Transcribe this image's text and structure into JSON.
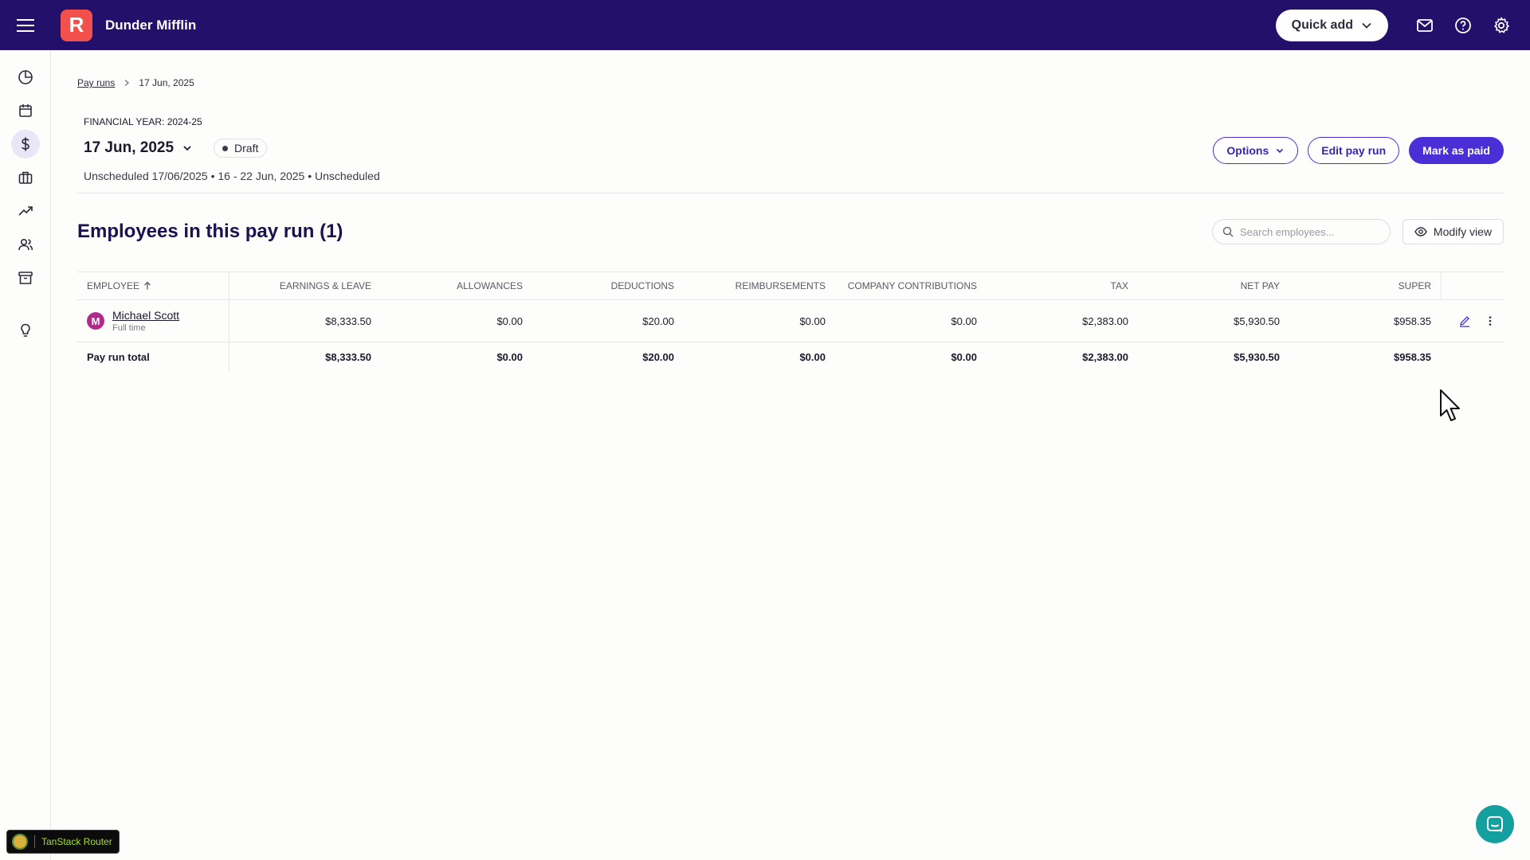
{
  "topbar": {
    "logo_letter": "R",
    "company": "Dunder Mifflin",
    "quick_add": "Quick add"
  },
  "breadcrumb": {
    "parent": "Pay runs",
    "current": "17 Jun, 2025"
  },
  "payrun": {
    "financial_year": "FINANCIAL YEAR: 2024-25",
    "date": "17 Jun, 2025",
    "status": "Draft",
    "subline": "Unscheduled 17/06/2025 • 16 - 22 Jun, 2025 • Unscheduled"
  },
  "actions": {
    "options": "Options",
    "edit": "Edit pay run",
    "mark_paid": "Mark as paid"
  },
  "section": {
    "title": "Employees in this pay run (1)",
    "search_placeholder": "Search employees...",
    "modify_view": "Modify view"
  },
  "table": {
    "headers": [
      "EMPLOYEE",
      "EARNINGS & LEAVE",
      "ALLOWANCES",
      "DEDUCTIONS",
      "REIMBURSEMENTS",
      "COMPANY CONTRIBUTIONS",
      "TAX",
      "NET PAY",
      "SUPER"
    ],
    "employee": {
      "initial": "M",
      "name": "Michael Scott",
      "type": "Full time",
      "values": [
        "$8,333.50",
        "$0.00",
        "$20.00",
        "$0.00",
        "$0.00",
        "$2,383.00",
        "$5,930.50",
        "$958.35"
      ]
    },
    "total": {
      "label": "Pay run total",
      "values": [
        "$8,333.50",
        "$0.00",
        "$20.00",
        "$0.00",
        "$0.00",
        "$2,383.00",
        "$5,930.50",
        "$958.35"
      ]
    }
  },
  "devtools": {
    "label": "TanStack Router"
  },
  "colors": {
    "topbar": "#22106b",
    "logo": "#f2504a",
    "primary": "#4b2fd6",
    "avatar": "#b02a8a",
    "chat": "#15a0a0"
  }
}
